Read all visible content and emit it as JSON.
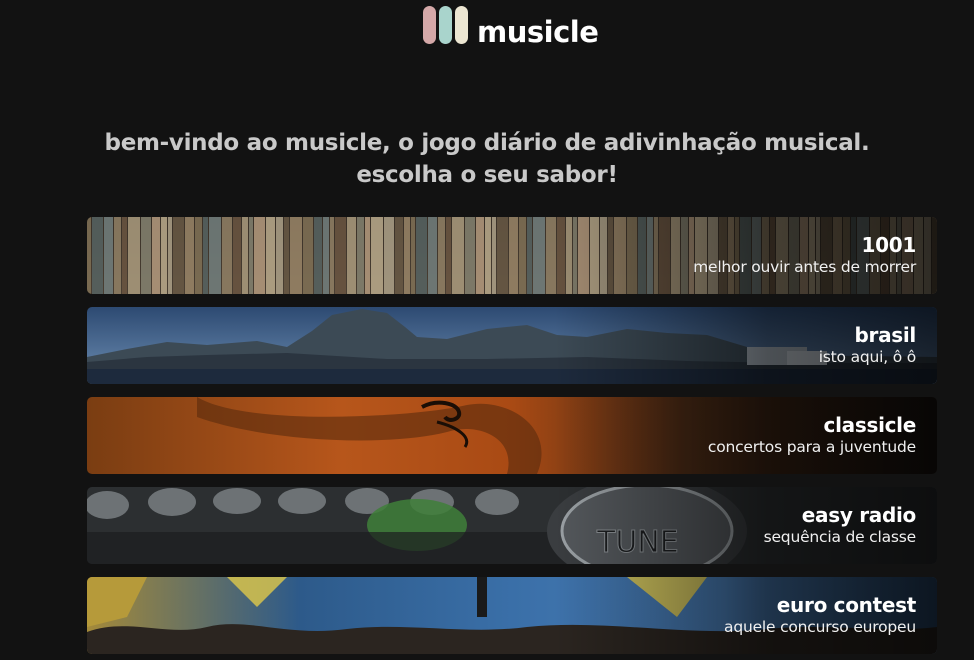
{
  "header": {
    "logo_text": "musicle",
    "logo_bar_colors": [
      "#d4a8a8",
      "#a9d4cc",
      "#ece6d2"
    ]
  },
  "welcome": {
    "line1": "bem-vindo ao musicle, o jogo diário de adivinhação musical.",
    "line2": "escolha o seu sabor!"
  },
  "flavors": [
    {
      "title": "1001",
      "subtitle": "melhor ouvir antes de morrer",
      "image": "vinyl-records-shelf"
    },
    {
      "title": "brasil",
      "subtitle": "isto aqui, ô ô",
      "image": "rio-de-janeiro-sugarloaf"
    },
    {
      "title": "classicle",
      "subtitle": "concertos para a juventude",
      "image": "violin-closeup"
    },
    {
      "title": "easy radio",
      "subtitle": "sequência de classe",
      "image": "radio-tune-knob"
    },
    {
      "title": "euro contest",
      "subtitle": "aquele concurso europeu",
      "image": "concert-crowd-flags"
    }
  ]
}
